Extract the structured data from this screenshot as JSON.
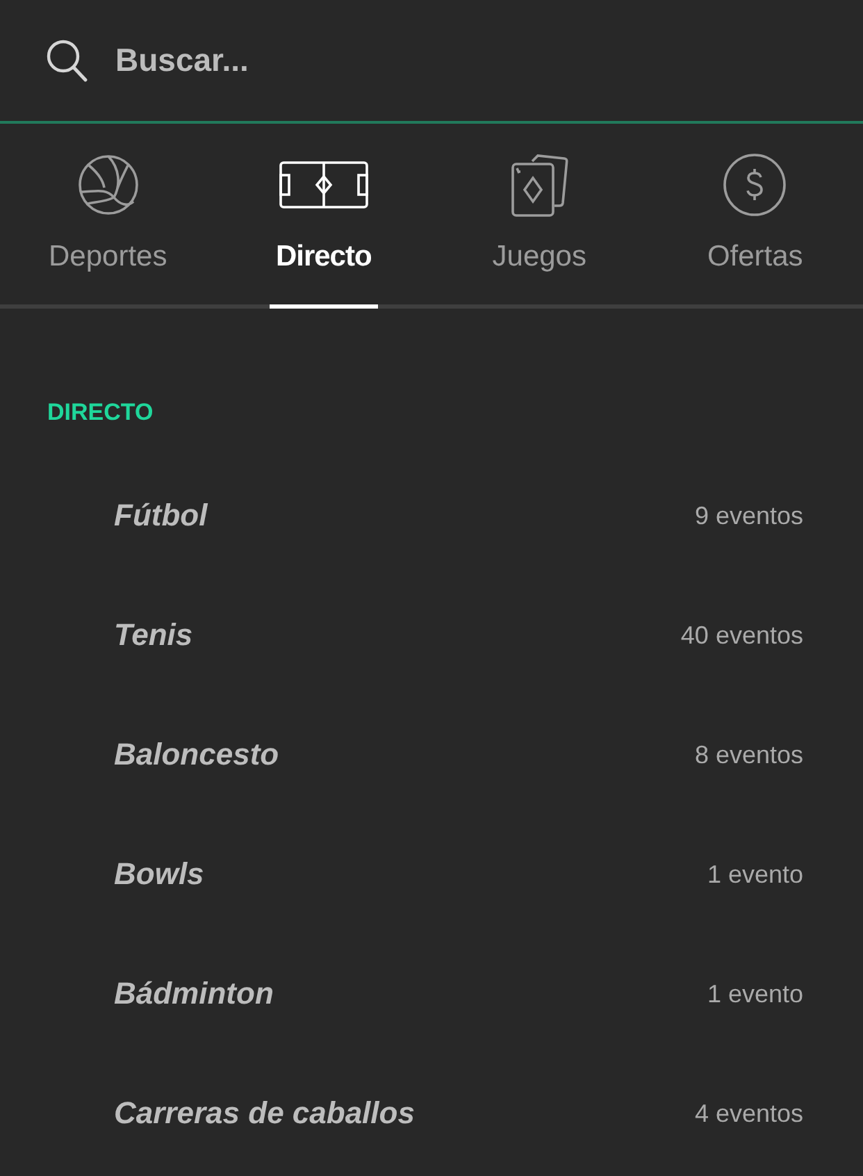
{
  "search": {
    "placeholder": "Buscar..."
  },
  "tabs": [
    {
      "label": "Deportes",
      "selected": false
    },
    {
      "label": "Directo",
      "selected": true
    },
    {
      "label": "Juegos",
      "selected": false
    },
    {
      "label": "Ofertas",
      "selected": false
    }
  ],
  "section": {
    "title": "DIRECTO",
    "items": [
      {
        "name": "Fútbol",
        "count": "9 eventos"
      },
      {
        "name": "Tenis",
        "count": "40 eventos"
      },
      {
        "name": "Baloncesto",
        "count": "8 eventos"
      },
      {
        "name": "Bowls",
        "count": "1 evento"
      },
      {
        "name": "Bádminton",
        "count": "1 evento"
      },
      {
        "name": "Carreras de caballos",
        "count": "4 eventos"
      }
    ]
  }
}
